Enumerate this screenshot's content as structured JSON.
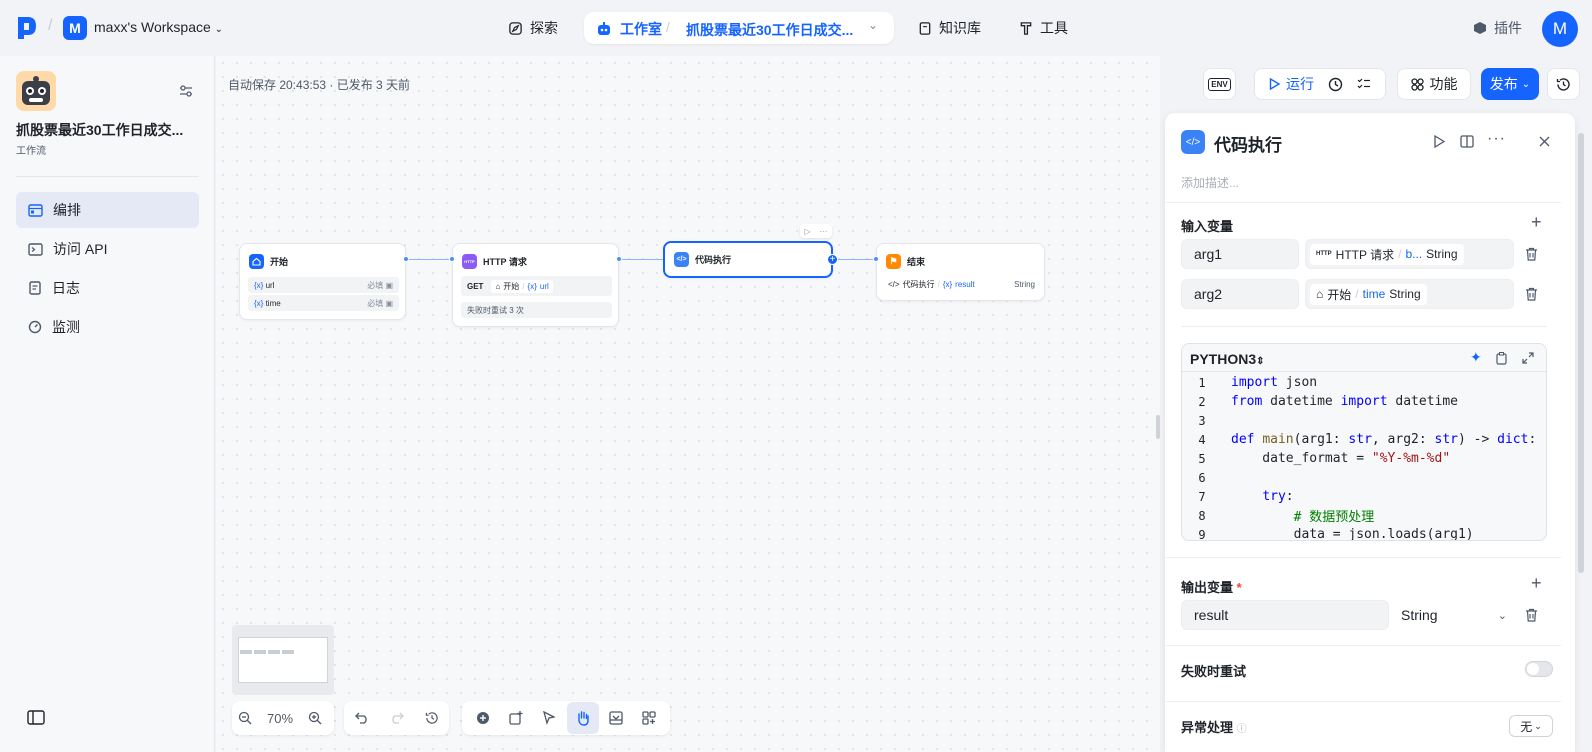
{
  "topbar": {
    "workspace_initial": "M",
    "workspace_name": "maxx's Workspace",
    "nav_explore": "探索",
    "nav_studio": "工作室",
    "breadcrumb_project": "抓股票最近30工作日成交...",
    "nav_knowledge": "知识库",
    "nav_tools": "工具",
    "nav_plugins": "插件",
    "user_initial": "M"
  },
  "sidebar": {
    "bot_title": "抓股票最近30工作日成交...",
    "bot_type": "工作流",
    "items": [
      {
        "label": "编排",
        "icon": "layout-icon"
      },
      {
        "label": "访问 API",
        "icon": "terminal-icon"
      },
      {
        "label": "日志",
        "icon": "log-icon"
      },
      {
        "label": "监测",
        "icon": "gauge-icon"
      }
    ]
  },
  "canvas": {
    "save_info": "自动保存 20:43:53 · 已发布 3 天前",
    "zoom": "70%",
    "nodes": {
      "start": {
        "title": "开始",
        "params": [
          {
            "name": "url",
            "req": "必填"
          },
          {
            "name": "time",
            "req": "必填"
          }
        ]
      },
      "http": {
        "title": "HTTP 请求",
        "method": "GET",
        "src": "开始",
        "var": "url",
        "retry": "失败时重试 3 次"
      },
      "code": {
        "title": "代码执行"
      },
      "end": {
        "title": "结束",
        "src": "代码执行",
        "var": "result",
        "type": "String"
      }
    }
  },
  "top_buttons": {
    "env": "ENV",
    "run": "运行",
    "features": "功能",
    "publish": "发布"
  },
  "panel": {
    "title": "代码执行",
    "desc_placeholder": "添加描述...",
    "input_section": "输入变量",
    "inputs": [
      {
        "name": "arg1",
        "src_icon": "HTTP",
        "src": "HTTP 请求",
        "var": "b...",
        "type": "String"
      },
      {
        "name": "arg2",
        "src_icon": "home",
        "src": "开始",
        "var": "time",
        "type": "String"
      }
    ],
    "language": "PYTHON3",
    "code": [
      "import json",
      "from datetime import datetime",
      "",
      "def main(arg1: str, arg2: str) -> dict:",
      "    date_format = \"%Y-%m-%d\"",
      "",
      "    try:",
      "        # 数据预处理",
      "        data = json.loads(arg1)"
    ],
    "output_section": "输出变量",
    "output_required": "*",
    "output_name": "result",
    "output_type": "String",
    "retry_label": "失败时重试",
    "exception_label": "异常处理",
    "exception_value": "无"
  },
  "colors": {
    "accent": "#1664ff",
    "end_node": "#ff8a00",
    "http_node": "#8b5cf6"
  }
}
